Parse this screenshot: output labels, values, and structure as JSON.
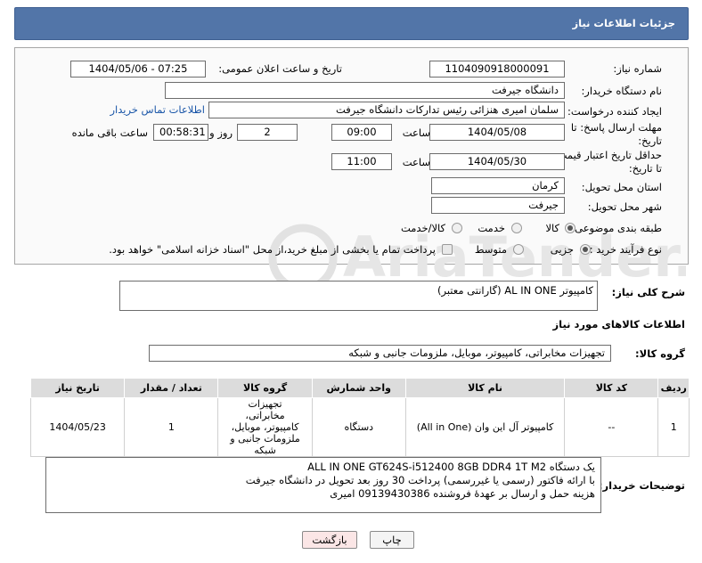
{
  "header": {
    "title": "جزئیات اطلاعات نیاز"
  },
  "fields": {
    "need_number_label": "شماره نیاز:",
    "need_number": "1104090918000091",
    "announce_label": "تاریخ و ساعت اعلان عمومی:",
    "announce_value": "1404/05/06 - 07:25",
    "buyer_org_label": "نام دستگاه خریدار:",
    "buyer_org": "دانشگاه جیرفت",
    "creator_label": "ایجاد کننده درخواست:",
    "creator": "سلمان امیری هنزائی رئیس تدارکات دانشگاه جیرفت",
    "contact_link": "اطلاعات تماس خریدار",
    "deadline_label_1": "مهلت ارسال پاسخ: تا",
    "deadline_label_2": "تاریخ:",
    "deadline_date": "1404/05/08",
    "time_label": "ساعت",
    "deadline_time": "09:00",
    "days_value": "2",
    "days_label": "روز و",
    "remaining_time": "00:58:31",
    "remaining_label": "ساعت باقی مانده",
    "validity_label_1": "حداقل تاریخ اعتبار قیمت:",
    "validity_label_2": "تا تاریخ:",
    "validity_date": "1404/05/30",
    "validity_time": "11:00",
    "province_label": "استان محل تحویل:",
    "province": "کرمان",
    "city_label": "شهر محل تحویل:",
    "city": "جیرفت",
    "category_label": "طبقه بندی موضوعی:",
    "category_options": [
      "کالا",
      "خدمت",
      "کالا/خدمت"
    ],
    "process_label": "نوع فرآیند خرید :",
    "process_options": [
      "جزیی",
      "متوسط"
    ],
    "payment_text": "پرداخت تمام یا بخشی از مبلغ خرید،از محل \"اسناد خزانه اسلامی\" خواهد بود."
  },
  "summary": {
    "label": "شرح کلی نیاز:",
    "value": "کامپیوتر AL IN ONE (گارانتی معتبر)"
  },
  "goods": {
    "section_title": "اطلاعات کالاهای مورد نیاز",
    "group_label": "گروه کالا:",
    "group_value": "تجهیزات مخابراتی، کامپیوتر، موبایل، ملزومات جانبی و شبکه",
    "columns": [
      "ردیف",
      "کد کالا",
      "نام کالا",
      "واحد شمارش",
      "گروه کالا",
      "تعداد / مقدار",
      "تاریخ نیاز"
    ],
    "rows": [
      {
        "index": "1",
        "code": "--",
        "name": "کامپیوتر آل این وان (All in One)",
        "unit": "دستگاه",
        "group": "تجهیزات مخابراتی، کامپیوتر، موبایل، ملزومات جانبی و شبکه",
        "qty": "1",
        "date": "1404/05/23"
      }
    ]
  },
  "buyer_notes": {
    "label": "توضیحات خریدار:",
    "lines": [
      "یک دستگاه ALL IN ONE GT624S-i512400 8GB DDR4 1T M2",
      "با ارائه فاکتور (رسمی یا غیررسمی) پرداخت 30 روز بعد تحویل در دانشگاه جیرفت",
      "هزینه حمل و ارسال بر عهدۀ فروشنده 09139430386 امیری"
    ]
  },
  "buttons": {
    "print": "چاپ",
    "back": "بازگشت"
  },
  "watermark": {
    "text": "AriaTender.neT"
  },
  "colors": {
    "header": "#5275a8",
    "link": "#1a56a8",
    "back_button": "#fbe6e6"
  }
}
